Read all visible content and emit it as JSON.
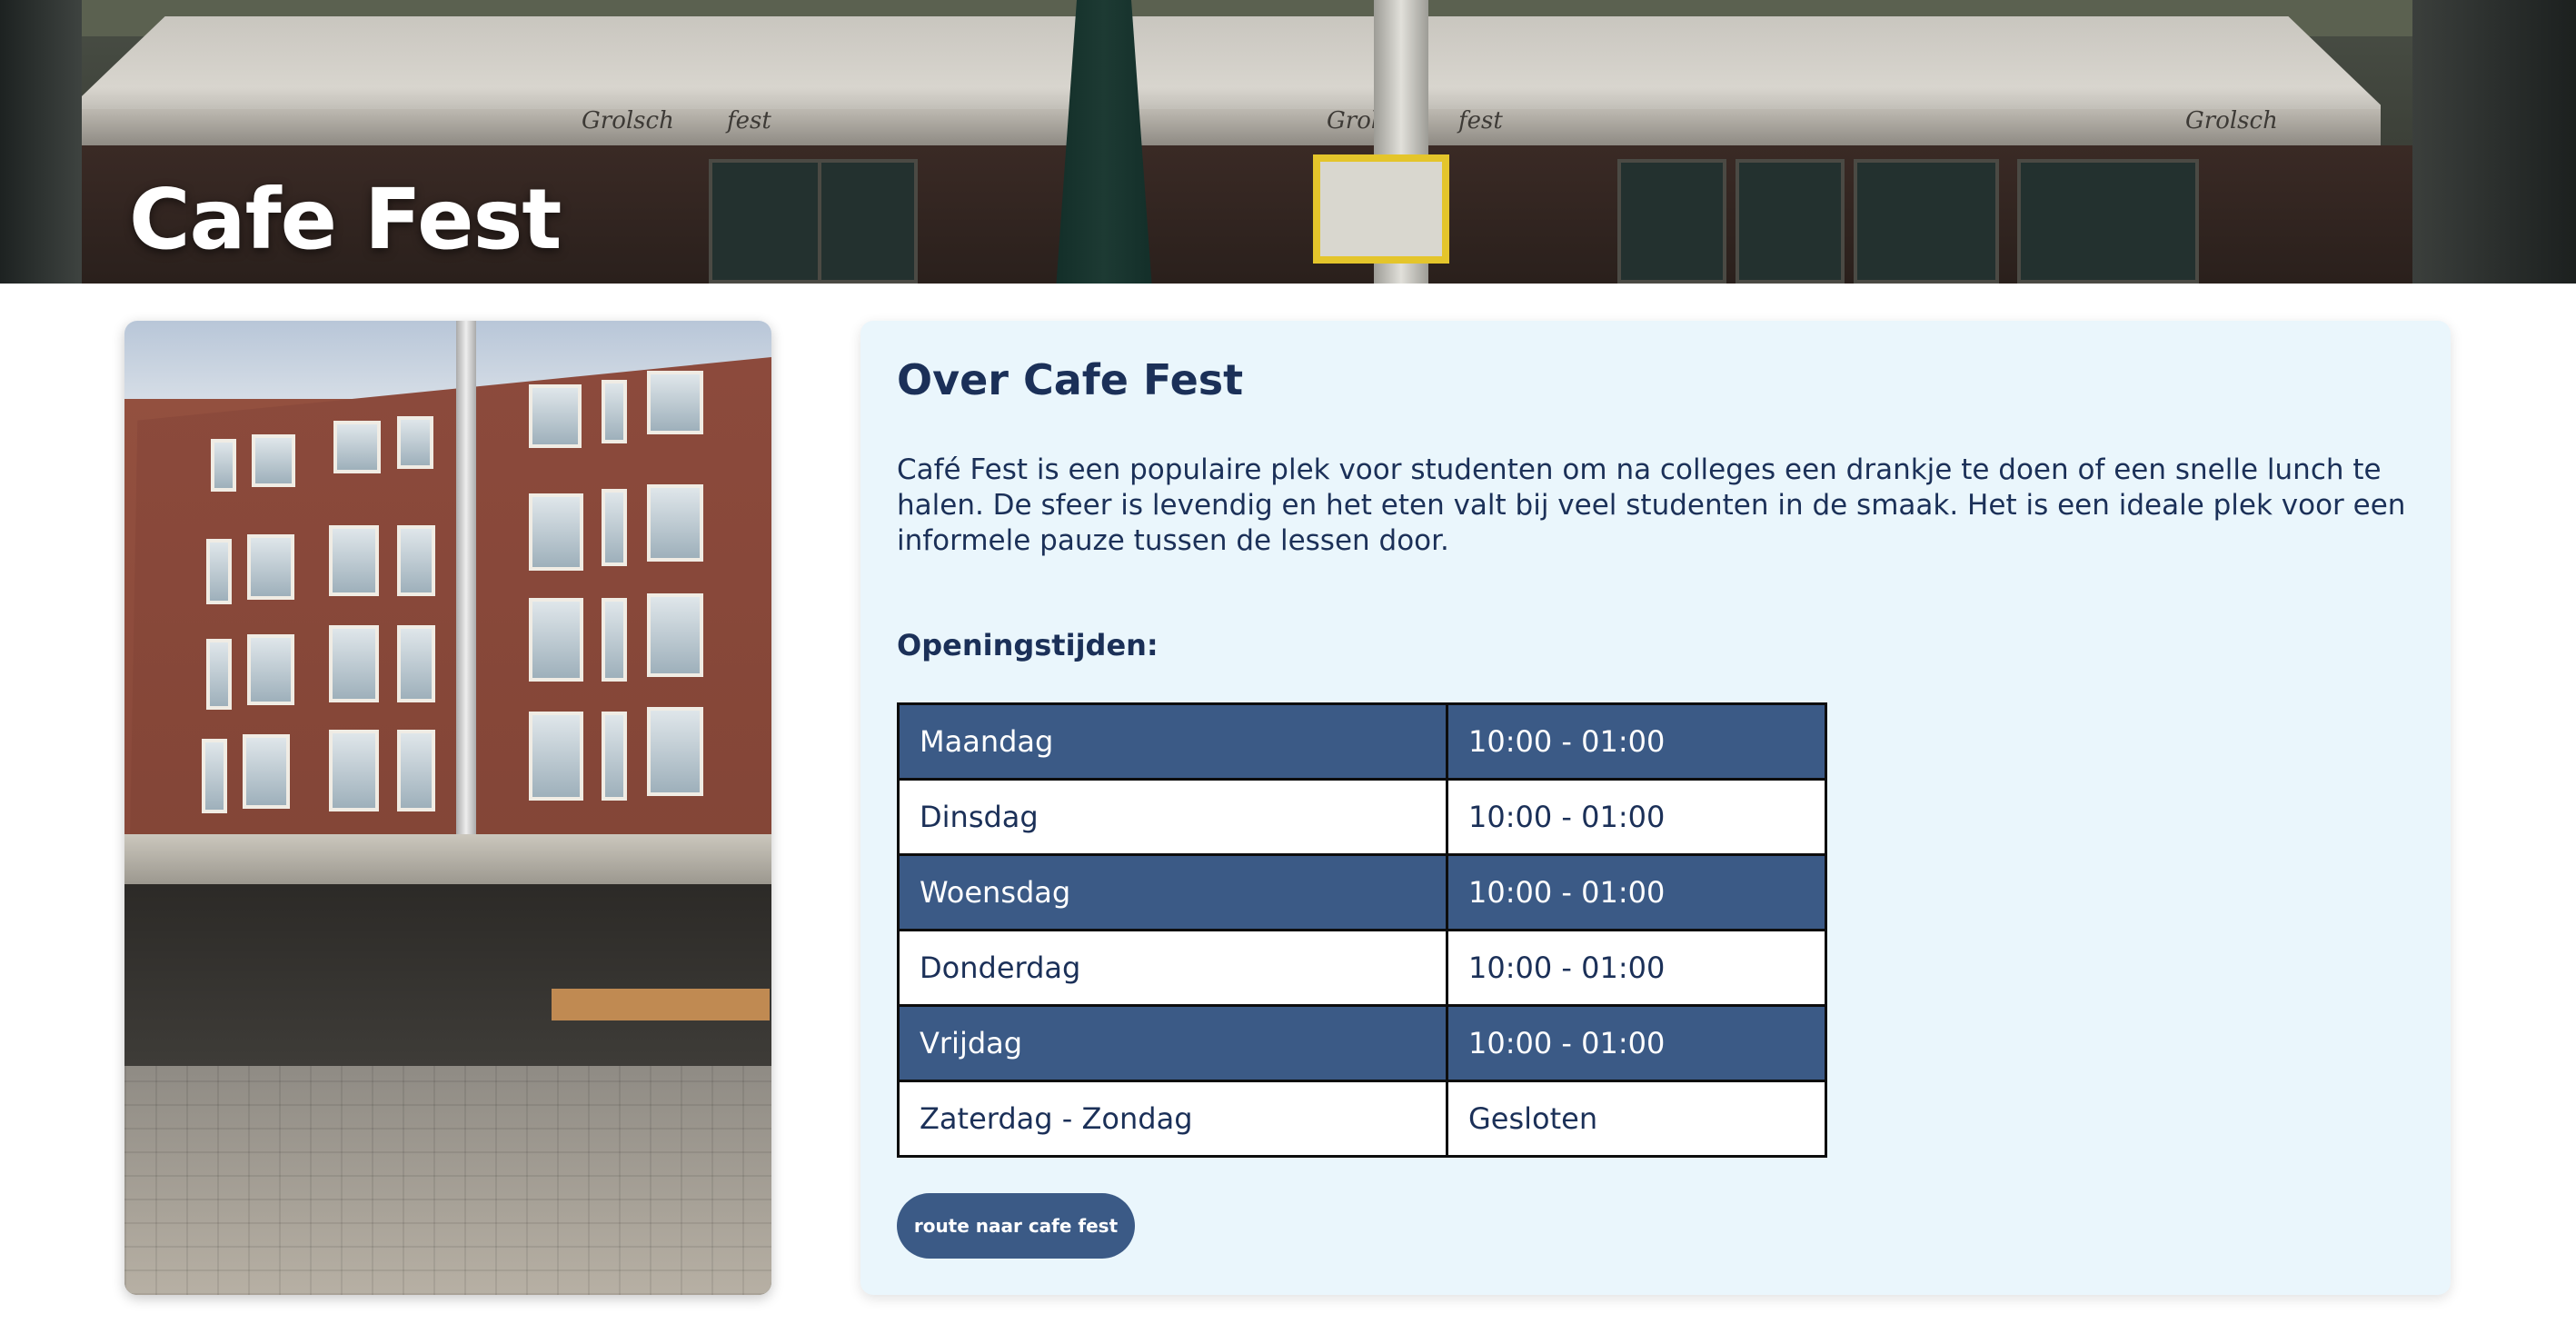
{
  "hero": {
    "title": "Cafe Fest",
    "awning_brands": [
      "Grolsch",
      "fest",
      "Grolsch",
      "fest",
      "Grolsch"
    ]
  },
  "about": {
    "title": "Over Cafe Fest",
    "description": "Café Fest is een populaire plek voor studenten om na colleges een drankje te doen of een snelle lunch te halen. De sfeer is levendig en het eten valt bij veel studenten in de smaak. Het is een ideale plek voor een informele pauze tussen de lessen door.",
    "hours_label": "Openingstijden:",
    "hours": [
      {
        "day": "Maandag",
        "time": "10:00 - 01:00"
      },
      {
        "day": "Dinsdag",
        "time": "10:00 - 01:00"
      },
      {
        "day": "Woensdag",
        "time": "10:00 - 01:00"
      },
      {
        "day": "Donderdag",
        "time": "10:00 - 01:00"
      },
      {
        "day": "Vrijdag",
        "time": "10:00 - 01:00"
      },
      {
        "day": "Zaterdag - Zondag",
        "time": "Gesloten"
      }
    ],
    "route_button": "route naar cafe fest"
  },
  "colors": {
    "primary": "#3b5a86",
    "text": "#1b3058",
    "card_bg": "#eaf6fc"
  }
}
